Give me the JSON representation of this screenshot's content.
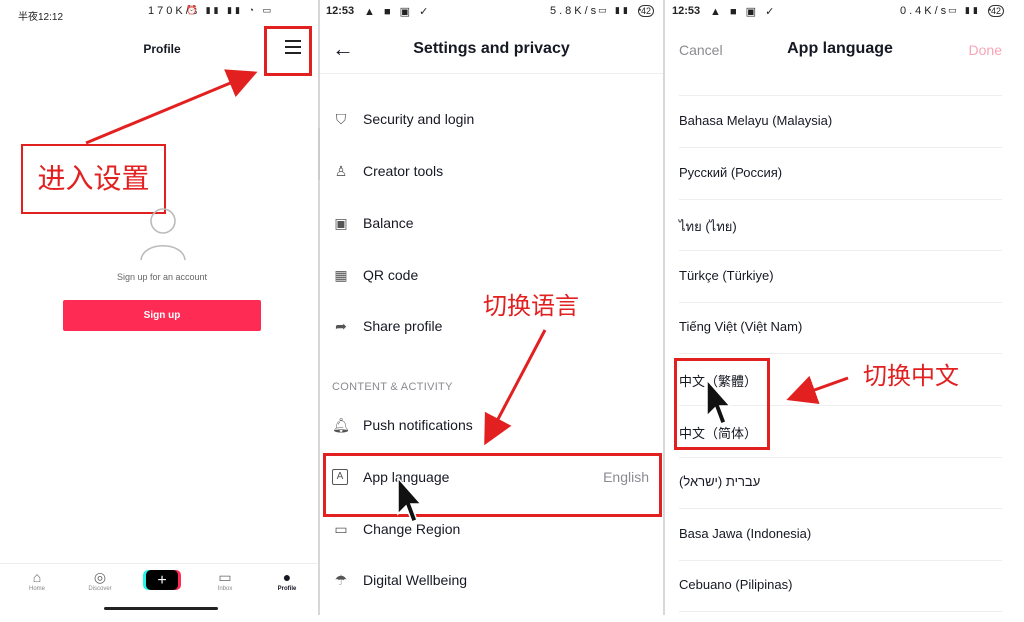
{
  "panel1": {
    "status": {
      "time": "半夜12:12",
      "right": "170K/s"
    },
    "title": "Profile",
    "annotation": "进入设置",
    "signup_prompt": "Sign up for an account",
    "signup_button": "Sign up",
    "tabs": [
      {
        "label": "Home",
        "icon": "home-icon"
      },
      {
        "label": "Discover",
        "icon": "compass-icon"
      },
      {
        "label": "",
        "icon": "plus-icon"
      },
      {
        "label": "Inbox",
        "icon": "inbox-icon"
      },
      {
        "label": "Profile",
        "icon": "person-icon"
      }
    ]
  },
  "panel2": {
    "status": {
      "time": "12:53",
      "right": "5.8K/s",
      "battery": "42"
    },
    "title": "Settings and privacy",
    "items_top": [
      {
        "label": "Security and login",
        "icon": "shield-icon"
      },
      {
        "label": "Creator tools",
        "icon": "person-star-icon"
      },
      {
        "label": "Balance",
        "icon": "wallet-icon"
      },
      {
        "label": "QR code",
        "icon": "qr-icon"
      },
      {
        "label": "Share profile",
        "icon": "share-icon"
      }
    ],
    "section_header": "CONTENT & ACTIVITY",
    "items_bottom": [
      {
        "label": "Push notifications",
        "icon": "bell-icon"
      },
      {
        "label": "App language",
        "value": "English",
        "icon": "language-icon"
      },
      {
        "label": "Change Region",
        "icon": "video-icon"
      },
      {
        "label": "Digital Wellbeing",
        "icon": "umbrella-icon"
      }
    ],
    "annotation": "切换语言"
  },
  "panel3": {
    "status": {
      "time": "12:53",
      "right": "0.4K/s",
      "battery": "42"
    },
    "cancel": "Cancel",
    "title": "App language",
    "done": "Done",
    "languages": [
      "Bahasa Melayu (Malaysia)",
      "Русский (Россия)",
      "ไทย (ไทย)",
      "Türkçe (Türkiye)",
      "Tiếng Việt (Việt Nam)",
      "中文（繁體）",
      "中文（简体）",
      "עברית (ישראל)",
      "Basa Jawa (Indonesia)",
      "Cebuano (Pilipinas)"
    ],
    "annotation": "切换中文"
  },
  "colors": {
    "accent": "#fe2c55",
    "annotation_red": "#e32020",
    "done_disabled": "#f7a5b7"
  }
}
